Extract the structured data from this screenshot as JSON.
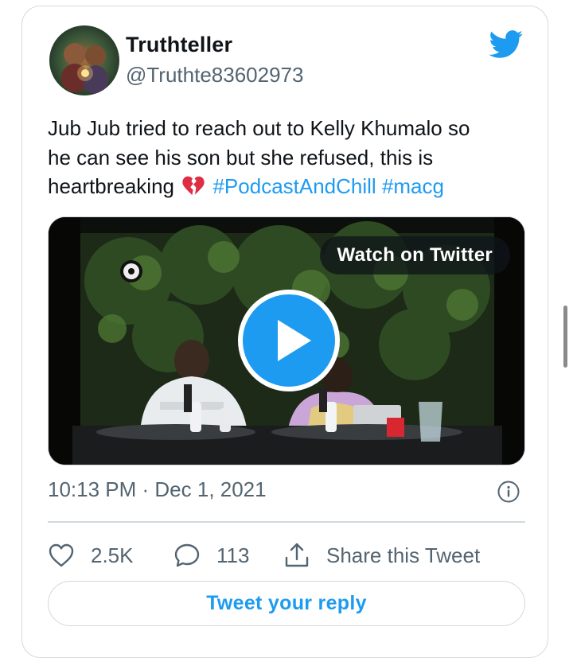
{
  "author": {
    "display_name": "Truthteller",
    "handle": "@Truthte83602973"
  },
  "tweet": {
    "text_line1": "Jub Jub tried to reach out to Kelly Khumalo so",
    "text_line2": "he can see his son but she refused, this is",
    "text_line3": "heartbreaking",
    "emoji": "broken-heart-icon",
    "hashtags": [
      "#PodcastAndChill",
      "#macg"
    ]
  },
  "media": {
    "watch_label": "Watch on Twitter"
  },
  "meta": {
    "timestamp": "10:13 PM · Dec 1, 2021"
  },
  "actions": {
    "likes": "2.5K",
    "replies": "113",
    "share_label": "Share this Tweet"
  },
  "reply": {
    "label": "Tweet your reply"
  },
  "colors": {
    "brand": "#1d9bf0",
    "text": "#0f1419",
    "muted": "#536471",
    "border": "#cfd9de"
  }
}
